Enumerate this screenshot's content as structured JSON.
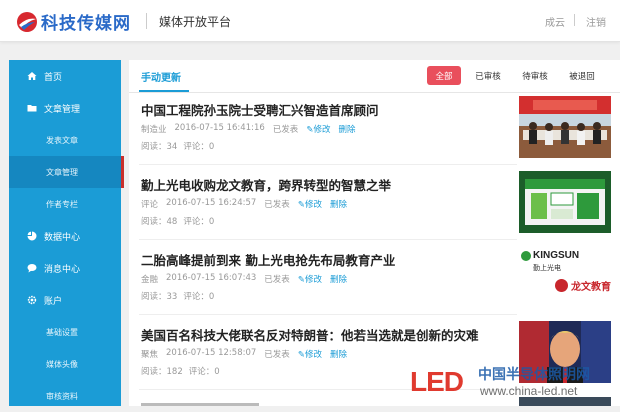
{
  "header": {
    "logo_text": "科技传媒网",
    "platform": "媒体开放平台",
    "user": "成云",
    "logout": "注销"
  },
  "sidebar": {
    "items": [
      {
        "label": "首页",
        "icon": "home-icon"
      },
      {
        "label": "文章管理",
        "icon": "folder-icon"
      },
      {
        "label": "发表文章"
      },
      {
        "label": "文章管理"
      },
      {
        "label": "作者专栏"
      },
      {
        "label": "数据中心",
        "icon": "pie-chart-icon"
      },
      {
        "label": "消息中心",
        "icon": "chat-icon"
      },
      {
        "label": "账户",
        "icon": "gear-icon"
      },
      {
        "label": "基础设置"
      },
      {
        "label": "媒体头像"
      },
      {
        "label": "审核资料"
      }
    ]
  },
  "main": {
    "tab": "手动更新",
    "filters": [
      "全部",
      "已审核",
      "待审核",
      "被退回"
    ],
    "articles": [
      {
        "title": "中国工程院孙玉院士受聘汇兴智造首席顾问",
        "category": "制造业",
        "date": "2016-07-15 16:41:16",
        "status": "已发表",
        "edit": "修改",
        "delete": "删除",
        "reads": "阅读：34",
        "comments": "评论：0"
      },
      {
        "title": "勤上光电收购龙文教育，跨界转型的智慧之举",
        "category": "评论",
        "date": "2016-07-15 16:24:57",
        "status": "已发表",
        "edit": "修改",
        "delete": "删除",
        "reads": "阅读：48",
        "comments": "评论：0"
      },
      {
        "title": "二胎高峰提前到来 勤上光电抢先布局教育产业",
        "category": "金融",
        "date": "2016-07-15 16:07:43",
        "status": "已发表",
        "edit": "修改",
        "delete": "删除",
        "reads": "阅读：33",
        "comments": "评论：0"
      },
      {
        "title": "美国百名科技大佬联名反对特朗普：他若当选就是创新的灾难",
        "category": "聚焦",
        "date": "2016-07-15 12:58:07",
        "status": "已发表",
        "edit": "修改",
        "delete": "删除",
        "reads": "阅读：182",
        "comments": "评论：0"
      }
    ],
    "thumb_texts": {
      "kingsun": "KINGSUN",
      "kingsun_cn": "勤上光电",
      "longwen": "龙文教育"
    }
  },
  "watermark": {
    "brand": "LED",
    "cn": "中国半导体照明网",
    "url": "www.china-led.net"
  },
  "colors": {
    "accent": "#1b9cd6",
    "active_filter": "#e94f5c",
    "logo_red": "#d7282f"
  }
}
